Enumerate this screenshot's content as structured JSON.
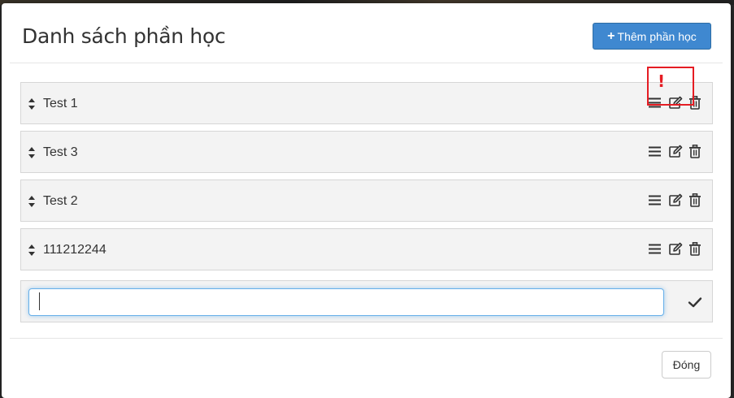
{
  "modal": {
    "title": "Danh sách phần học",
    "add_button_label": "Thêm phần học",
    "close_button_label": "Đóng"
  },
  "sections": [
    {
      "name": "Test 1"
    },
    {
      "name": "Test 3"
    },
    {
      "name": "Test 2"
    },
    {
      "name": "111212244"
    }
  ],
  "new_section": {
    "value": "",
    "placeholder": ""
  },
  "annotation": {
    "mark": "!"
  },
  "icons": {
    "sort": "sort-icon",
    "reorder": "bars-icon",
    "edit": "edit-icon",
    "delete": "trash-icon",
    "confirm": "check-icon",
    "add": "plus-icon"
  },
  "colors": {
    "primary": "#3f88d0",
    "annotation": "#e51c23",
    "row_background": "#f3f3f3",
    "focus_border": "#66afe9"
  }
}
